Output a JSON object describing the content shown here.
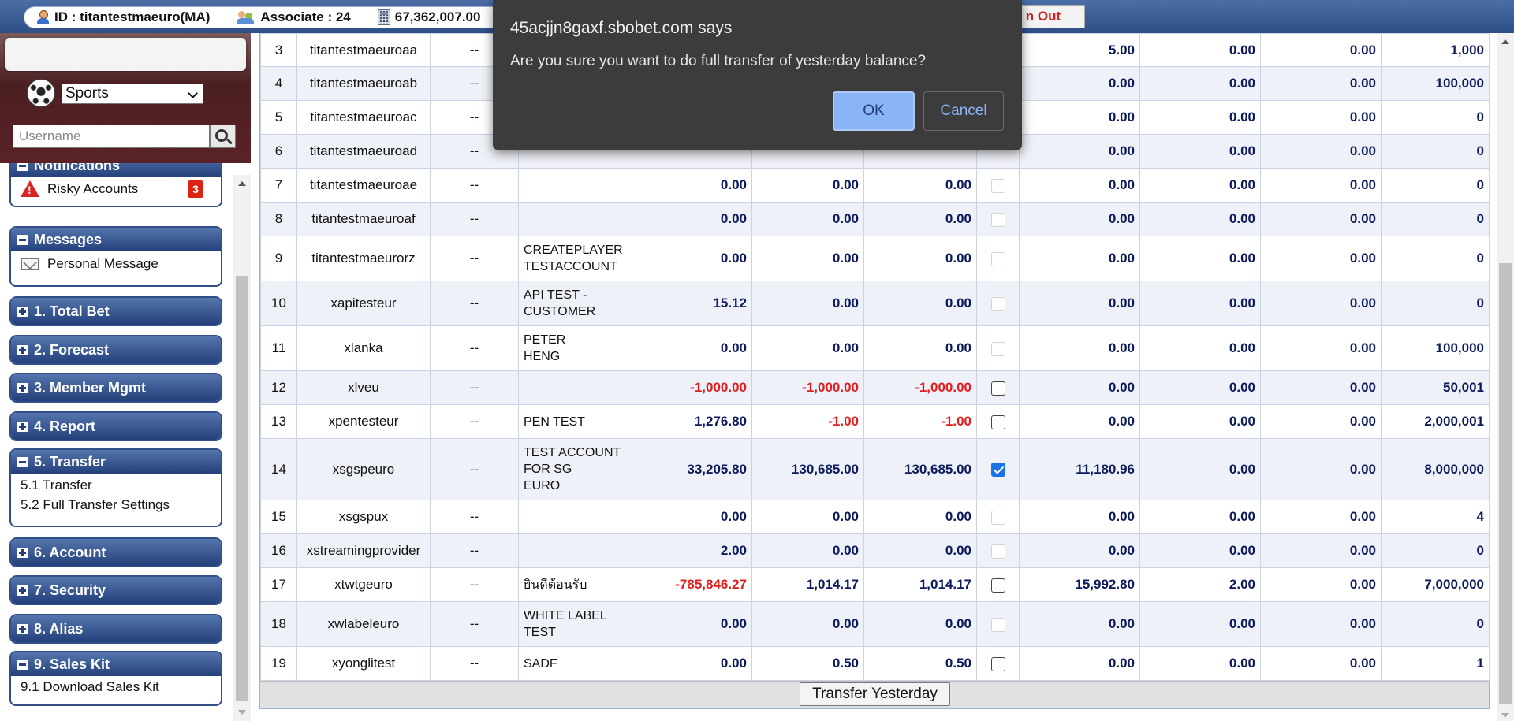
{
  "topbar": {
    "id_text": "ID : titantestmaeuro(MA)",
    "associate_text": "Associate : 24",
    "balance_text": "67,362,007.00",
    "logout_partial": "n Out"
  },
  "sidebar": {
    "sport_select": "Sports",
    "username_placeholder": "Username",
    "notifications_title": "Notifications",
    "risky_label": "Risky Accounts",
    "risky_count": "3",
    "messages_title": "Messages",
    "personal_message": "Personal Message",
    "menu": [
      {
        "label": "1. Total Bet"
      },
      {
        "label": "2. Forecast"
      },
      {
        "label": "3. Member Mgmt"
      },
      {
        "label": "4. Report"
      },
      {
        "label": "5. Transfer"
      },
      {
        "label": "6. Account"
      },
      {
        "label": "7. Security"
      },
      {
        "label": "8. Alias"
      },
      {
        "label": "9. Sales Kit"
      }
    ],
    "transfer_items": [
      "5.1 Transfer",
      "5.2 Full Transfer Settings"
    ],
    "saleskit_items": [
      "9.1 Download Sales Kit"
    ]
  },
  "table": {
    "rows": [
      {
        "no": "3",
        "user": "titantestmaeuroaa",
        "st": "--",
        "name": "",
        "c1": "",
        "c2": "",
        "c3": "",
        "cb": "hidden",
        "c4": "5.00",
        "c5": "0.00",
        "c6": "0.00",
        "c7": "1,000"
      },
      {
        "no": "4",
        "user": "titantestmaeuroab",
        "st": "--",
        "name": "",
        "c1": "",
        "c2": "",
        "c3": "",
        "cb": "hidden",
        "c4": "0.00",
        "c5": "0.00",
        "c6": "0.00",
        "c7": "100,000"
      },
      {
        "no": "5",
        "user": "titantestmaeuroac",
        "st": "--",
        "name": "",
        "c1": "",
        "c2": "",
        "c3": "",
        "cb": "hidden",
        "c4": "0.00",
        "c5": "0.00",
        "c6": "0.00",
        "c7": "0"
      },
      {
        "no": "6",
        "user": "titantestmaeuroad",
        "st": "--",
        "name": "",
        "c1": "",
        "c2": "",
        "c3": "",
        "cb": "hidden",
        "c4": "0.00",
        "c5": "0.00",
        "c6": "0.00",
        "c7": "0"
      },
      {
        "no": "7",
        "user": "titantestmaeuroae",
        "st": "--",
        "name": "",
        "c1": "0.00",
        "c2": "0.00",
        "c3": "0.00",
        "cb": "dis",
        "c4": "0.00",
        "c5": "0.00",
        "c6": "0.00",
        "c7": "0"
      },
      {
        "no": "8",
        "user": "titantestmaeuroaf",
        "st": "--",
        "name": "",
        "c1": "0.00",
        "c2": "0.00",
        "c3": "0.00",
        "cb": "dis",
        "c4": "0.00",
        "c5": "0.00",
        "c6": "0.00",
        "c7": "0"
      },
      {
        "no": "9",
        "user": "titantestmaeurorz",
        "st": "--",
        "name": "CREATEPLAYER\nTESTACCOUNT",
        "c1": "0.00",
        "c2": "0.00",
        "c3": "0.00",
        "cb": "dis",
        "c4": "0.00",
        "c5": "0.00",
        "c6": "0.00",
        "c7": "0"
      },
      {
        "no": "10",
        "user": "xapitesteur",
        "st": "--",
        "name": "API TEST -\nCUSTOMER",
        "c1": "15.12",
        "c2": "0.00",
        "c3": "0.00",
        "cb": "dis",
        "c4": "0.00",
        "c5": "0.00",
        "c6": "0.00",
        "c7": "0"
      },
      {
        "no": "11",
        "user": "xlanka",
        "st": "--",
        "name": "PETER\nHENG",
        "c1": "0.00",
        "c2": "0.00",
        "c3": "0.00",
        "cb": "dis",
        "c4": "0.00",
        "c5": "0.00",
        "c6": "0.00",
        "c7": "100,000"
      },
      {
        "no": "12",
        "user": "xlveu",
        "st": "--",
        "name": "",
        "c1": "-1,000.00",
        "c2": "-1,000.00",
        "c3": "-1,000.00",
        "cb": "off",
        "c4": "0.00",
        "c5": "0.00",
        "c6": "0.00",
        "c7": "50,001"
      },
      {
        "no": "13",
        "user": "xpentesteur",
        "st": "--",
        "name": "PEN TEST",
        "c1": "1,276.80",
        "c2": "-1.00",
        "c3": "-1.00",
        "cb": "off",
        "c4": "0.00",
        "c5": "0.00",
        "c6": "0.00",
        "c7": "2,000,001"
      },
      {
        "no": "14",
        "user": "xsgspeuro",
        "st": "--",
        "name": "TEST ACCOUNT\nFOR SG\nEURO",
        "c1": "33,205.80",
        "c2": "130,685.00",
        "c3": "130,685.00",
        "cb": "on",
        "c4": "11,180.96",
        "c5": "0.00",
        "c6": "0.00",
        "c7": "8,000,000"
      },
      {
        "no": "15",
        "user": "xsgspux",
        "st": "--",
        "name": "",
        "c1": "0.00",
        "c2": "0.00",
        "c3": "0.00",
        "cb": "dis",
        "c4": "0.00",
        "c5": "0.00",
        "c6": "0.00",
        "c7": "4"
      },
      {
        "no": "16",
        "user": "xstreamingprovider",
        "st": "--",
        "name": "",
        "c1": "2.00",
        "c2": "0.00",
        "c3": "0.00",
        "cb": "dis",
        "c4": "0.00",
        "c5": "0.00",
        "c6": "0.00",
        "c7": "0"
      },
      {
        "no": "17",
        "user": "xtwtgeuro",
        "st": "--",
        "name": "ยินดีต้อนรับ",
        "c1": "-785,846.27",
        "c2": "1,014.17",
        "c3": "1,014.17",
        "cb": "off",
        "c4": "15,992.80",
        "c5": "2.00",
        "c6": "0.00",
        "c7": "7,000,000"
      },
      {
        "no": "18",
        "user": "xwlabeleuro",
        "st": "--",
        "name": "WHITE LABEL\nTEST",
        "c1": "0.00",
        "c2": "0.00",
        "c3": "0.00",
        "cb": "dis",
        "c4": "0.00",
        "c5": "0.00",
        "c6": "0.00",
        "c7": "0"
      },
      {
        "no": "19",
        "user": "xyonglitest",
        "st": "--",
        "name": "SADF",
        "c1": "0.00",
        "c2": "0.50",
        "c3": "0.50",
        "cb": "off",
        "c4": "0.00",
        "c5": "0.00",
        "c6": "0.00",
        "c7": "1"
      }
    ],
    "transfer_button": "Transfer Yesterday"
  },
  "dialog": {
    "title": "45acjjn8gaxf.sbobet.com says",
    "message": "Are you sure you want to do full transfer of yesterday balance?",
    "ok": "OK",
    "cancel": "Cancel"
  },
  "colors": {
    "negative": "#e21f1f",
    "positive": "#0c1a5c",
    "accent": "#23407a"
  }
}
